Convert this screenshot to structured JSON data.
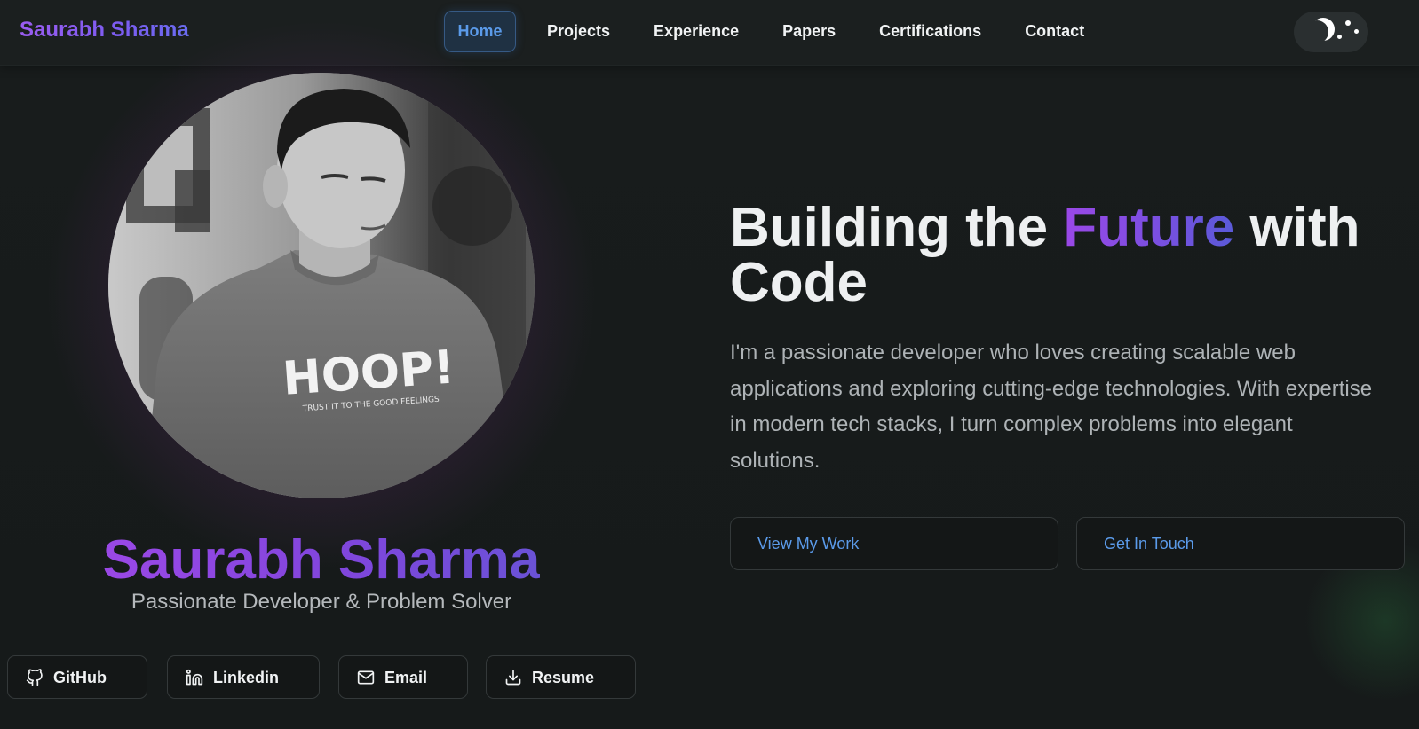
{
  "navbar": {
    "brand": "Saurabh Sharma",
    "links": [
      {
        "label": "Home",
        "active": true
      },
      {
        "label": "Projects",
        "active": false
      },
      {
        "label": "Experience",
        "active": false
      },
      {
        "label": "Papers",
        "active": false
      },
      {
        "label": "Certifications",
        "active": false
      },
      {
        "label": "Contact",
        "active": false
      }
    ],
    "theme_toggle_icon": "moon-stars-icon"
  },
  "hero": {
    "profile_photo": "profile-photo",
    "name": "Saurabh Sharma",
    "role": "Passionate Developer & Problem Solver",
    "headline_before": "Building the ",
    "headline_accent": "Future",
    "headline_after": " with Code",
    "intro": "I'm a passionate developer who loves creating scalable web applications and exploring cutting-edge technologies. With expertise in modern tech stacks, I turn complex problems into elegant solutions.",
    "cta_primary": "View My Work",
    "cta_secondary": "Get In Touch"
  },
  "social": [
    {
      "label": "GitHub",
      "icon": "github-icon"
    },
    {
      "label": "Linkedin",
      "icon": "linkedin-icon"
    },
    {
      "label": "Email",
      "icon": "mail-icon"
    },
    {
      "label": "Resume",
      "icon": "download-icon"
    }
  ],
  "colors": {
    "background": "#161a1a",
    "accent_purple": "#8a46e0",
    "link_blue": "#5b9bea"
  }
}
